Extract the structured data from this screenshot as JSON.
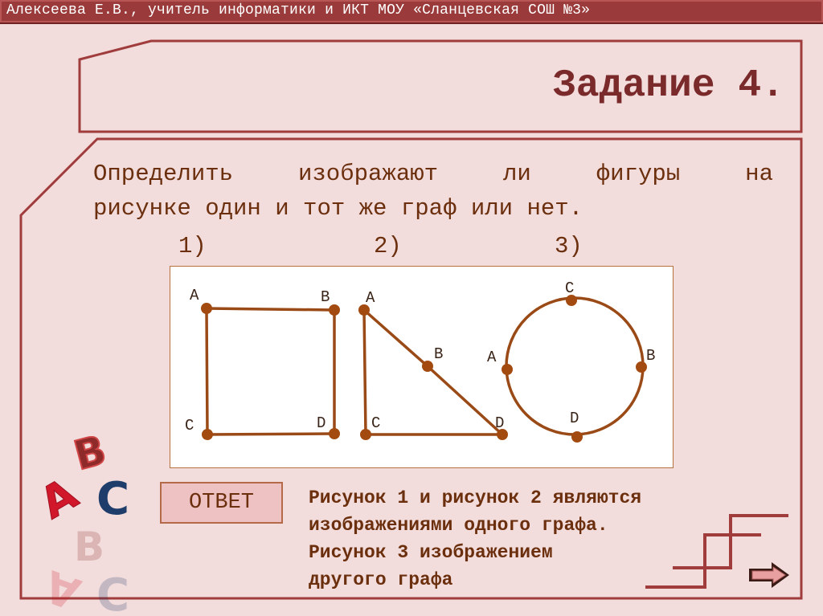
{
  "header": {
    "author_line": "Алексеева Е.В., учитель информатики и ИКТ МОУ «Сланцевская СОШ №3»"
  },
  "slide": {
    "title": "Задание 4.",
    "question": {
      "line1_words": [
        "Определить",
        "изображают",
        "ли",
        "фигуры",
        "на"
      ],
      "line2": "рисунке один и тот же граф или нет."
    },
    "figure_labels": [
      "1)",
      "2)",
      "3)"
    ],
    "figures": [
      {
        "id": 1,
        "shape": "square",
        "vertices": [
          "A",
          "B",
          "C",
          "D"
        ],
        "edges": [
          [
            "A",
            "B"
          ],
          [
            "B",
            "D"
          ],
          [
            "D",
            "C"
          ],
          [
            "C",
            "A"
          ]
        ]
      },
      {
        "id": 2,
        "shape": "triangle",
        "vertices": [
          "A",
          "B",
          "C",
          "D"
        ],
        "edges": [
          [
            "A",
            "B"
          ],
          [
            "B",
            "D"
          ],
          [
            "D",
            "C"
          ],
          [
            "C",
            "A"
          ]
        ]
      },
      {
        "id": 3,
        "shape": "circle",
        "vertices": [
          "C",
          "A",
          "B",
          "D"
        ],
        "edges": [
          [
            "C",
            "B"
          ],
          [
            "B",
            "D"
          ],
          [
            "D",
            "A"
          ],
          [
            "A",
            "C"
          ]
        ]
      }
    ],
    "answer_button_label": "ОТВЕТ",
    "answer_lines": [
      "Рисунок 1 и рисунок 2 являются",
      "изображениями одного графа.",
      "Рисунок 3 изображением",
      "другого графа"
    ],
    "decor_letters": [
      "A",
      "B",
      "C"
    ]
  },
  "navigation": {
    "next_icon": "right-arrow-icon"
  },
  "colors": {
    "accent": "#9a3a3a",
    "frame": "#a03c3c",
    "text": "#6b2f0e",
    "graph_line": "#9a4a16",
    "graph_node": "#a24a10",
    "background": "#f2dcdc"
  }
}
